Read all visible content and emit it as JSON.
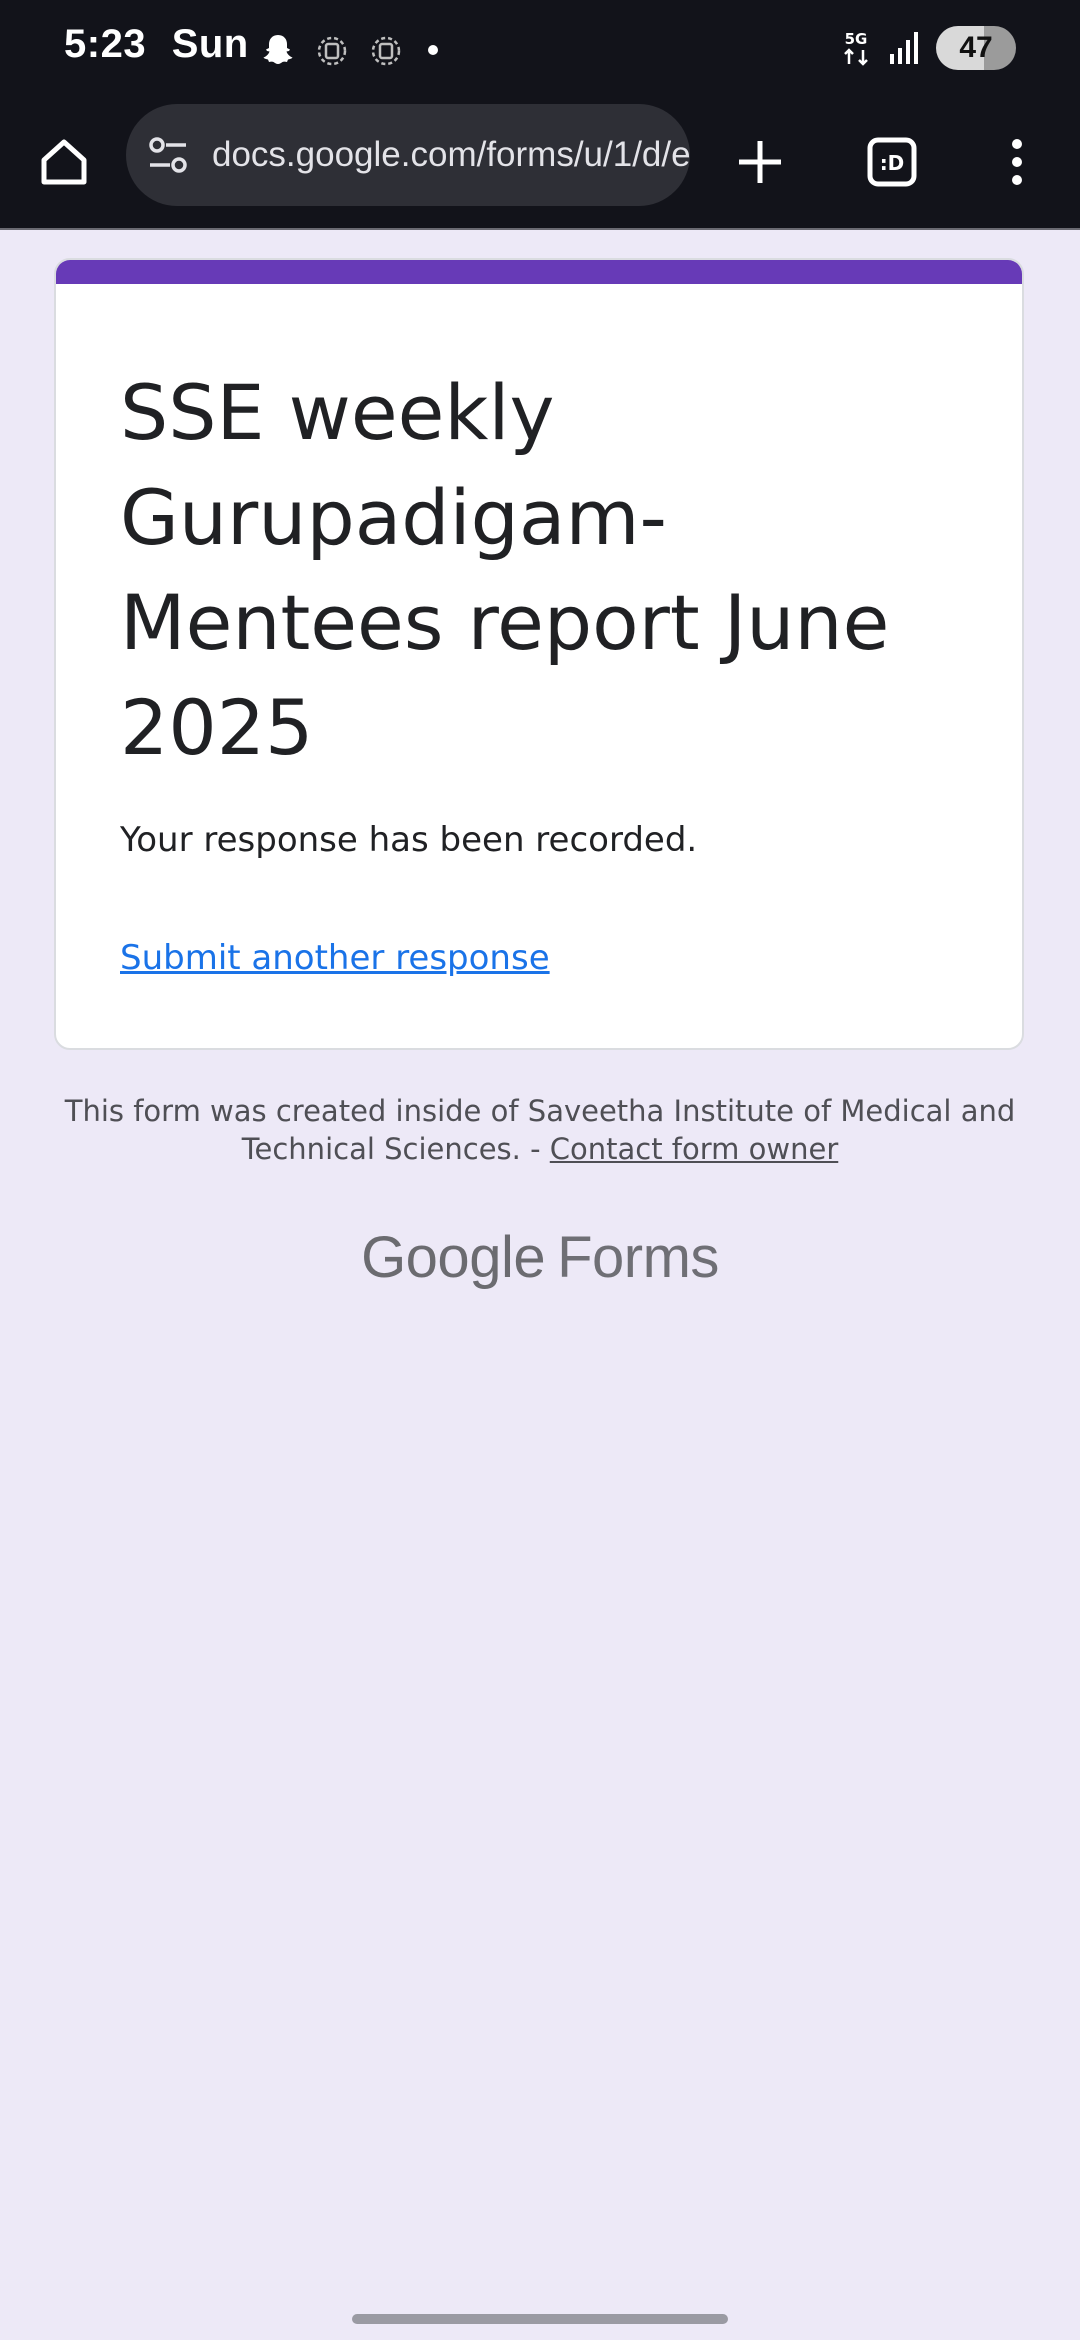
{
  "status_bar": {
    "time": "5:23",
    "day": "Sun",
    "network": "5G",
    "battery": "47"
  },
  "browser": {
    "url": "docs.google.com/forms/u/1/d/e",
    "tab_count_label": ":D"
  },
  "form": {
    "accent_color": "#673ab7",
    "title": "SSE weekly Gurupadigam-Mentees report June 2025",
    "confirmation": "Your response has been recorded.",
    "submit_another": "Submit another response"
  },
  "footer": {
    "created_text": "This form was created inside of Saveetha Institute of Medical and Technical Sciences. - ",
    "contact_link": "Contact form owner",
    "brand_google": "Google",
    "brand_forms": "Forms"
  },
  "icons": {
    "home": "home-icon",
    "site_settings": "tune-icon",
    "new_tab": "plus-icon",
    "tabs": "tab-switcher-icon",
    "menu": "more-vert-icon",
    "notifications": [
      "snapchat-icon",
      "app-icon",
      "app-icon"
    ]
  }
}
